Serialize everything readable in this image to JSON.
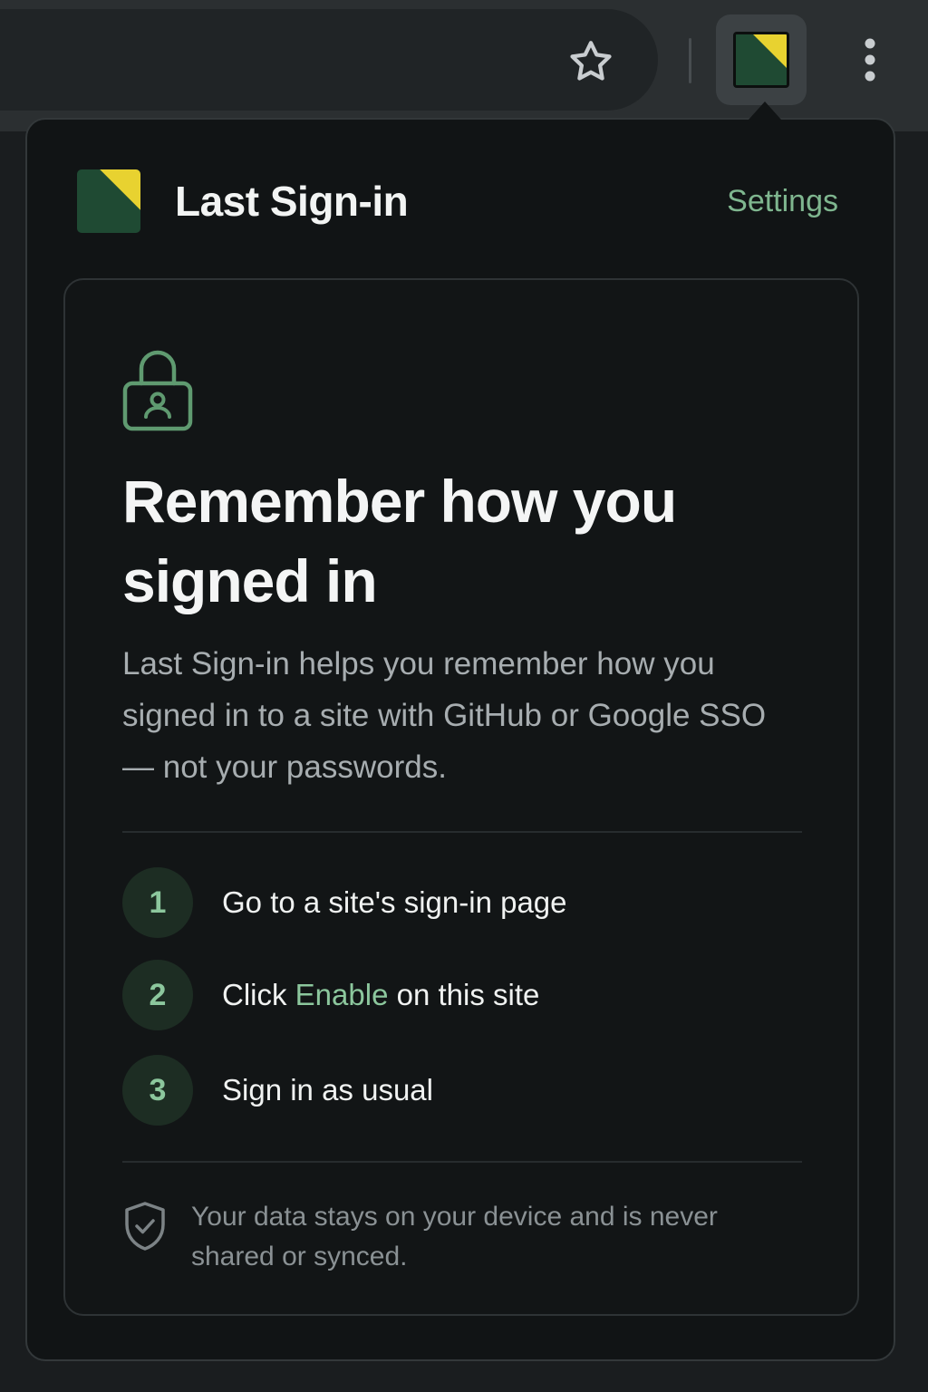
{
  "browser": {
    "toolbar_icons": [
      "star-icon",
      "extension-logo-icon",
      "more-vertical-icon"
    ]
  },
  "colors": {
    "accent_green": "#7fb68f",
    "logo_green": "#1f4a33",
    "logo_yellow": "#e8d230",
    "background": "#111415"
  },
  "popup": {
    "header": {
      "title": "Last Sign-in",
      "settings_label": "Settings"
    },
    "hero": {
      "icon": "lock-user-icon",
      "title": "Remember how you signed in",
      "description": "Last Sign-in helps you remember how you signed in to a site with GitHub or Google SSO — not your passwords."
    },
    "steps": [
      {
        "number": "1",
        "text": "Go to a site's sign-in page"
      },
      {
        "number": "2",
        "text_before": "Click ",
        "accent": "Enable",
        "text_after": " on this site"
      },
      {
        "number": "3",
        "text": "Sign in as usual"
      }
    ],
    "privacy": {
      "icon": "shield-check-icon",
      "text": "Your data stays on your device and is never shared or synced."
    }
  }
}
